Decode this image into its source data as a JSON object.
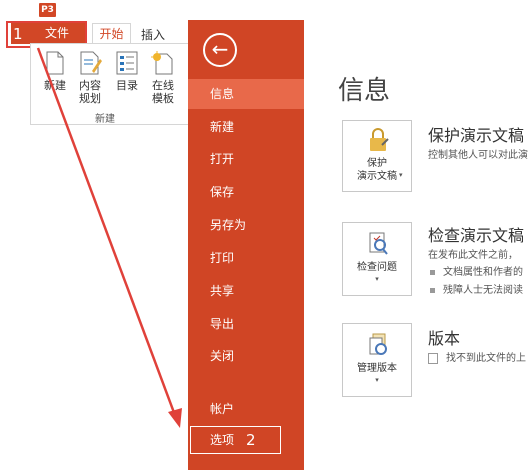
{
  "app": {
    "logo_text": "P3"
  },
  "ribbon": {
    "file_tab": "文件",
    "home_tab": "开始",
    "insert_tab": "插入",
    "buttons": [
      {
        "label": "新建"
      },
      {
        "label": "内容\n规划"
      },
      {
        "label": "目录"
      },
      {
        "label": "在线\n模板"
      }
    ],
    "group_label": "新建"
  },
  "annotations": {
    "step1": "1",
    "step2": "2",
    "arrow_color": "#e0413a"
  },
  "backstage": {
    "back_icon": "back-arrow-icon",
    "nav": [
      {
        "label": "信息",
        "active": true
      },
      {
        "label": "新建"
      },
      {
        "label": "打开"
      },
      {
        "label": "保存"
      },
      {
        "label": "另存为"
      },
      {
        "label": "打印"
      },
      {
        "label": "共享"
      },
      {
        "label": "导出"
      },
      {
        "label": "关闭"
      }
    ],
    "bottom_nav": [
      {
        "label": "帐户"
      },
      {
        "label": "选项"
      }
    ],
    "accent": "#d04525"
  },
  "content": {
    "title": "信息",
    "sections": [
      {
        "button_label": "保护\n演示文稿",
        "title": "保护演示文稿",
        "desc": "控制其他人可以对此演",
        "icon": "lock-icon"
      },
      {
        "button_label": "检查问题",
        "title": "检查演示文稿",
        "desc": "在发布此文件之前，",
        "bullets": [
          "文档属性和作者的",
          "残障人士无法阅读"
        ],
        "icon": "inspect-icon"
      },
      {
        "button_label": "管理版本",
        "title": "版本",
        "desc": "找不到此文件的上",
        "icon": "versions-icon"
      }
    ]
  }
}
